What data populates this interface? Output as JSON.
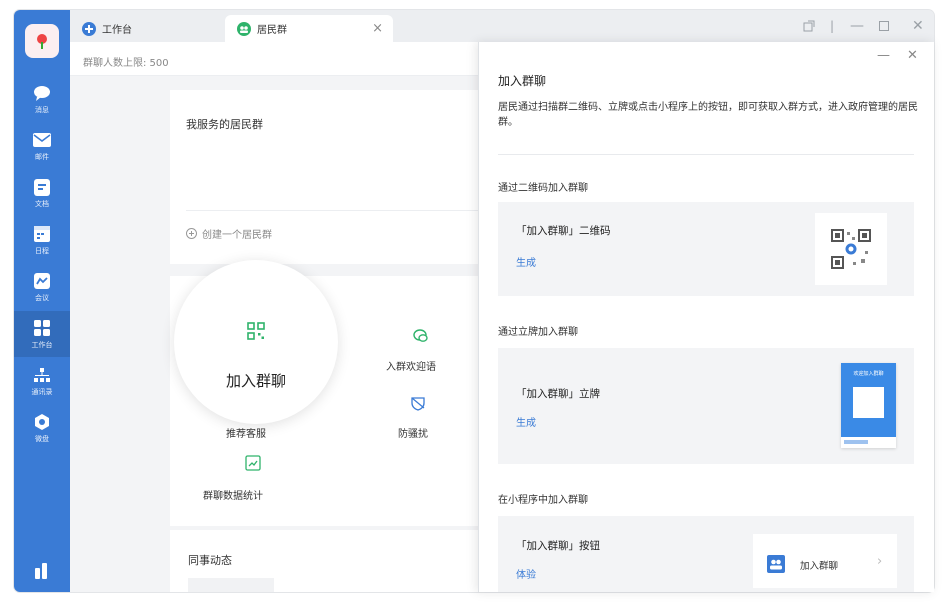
{
  "sidebar": {
    "items": [
      {
        "label": "消息",
        "icon": "chat-icon"
      },
      {
        "label": "邮件",
        "icon": "mail-icon"
      },
      {
        "label": "文档",
        "icon": "document-icon"
      },
      {
        "label": "日程",
        "icon": "calendar-icon"
      },
      {
        "label": "会议",
        "icon": "meeting-icon"
      },
      {
        "label": "工作台",
        "icon": "grid-icon"
      },
      {
        "label": "通讯录",
        "icon": "contacts-icon"
      },
      {
        "label": "微盘",
        "icon": "disk-icon"
      }
    ]
  },
  "tabs": [
    {
      "label": "工作台",
      "icon": "workbench-icon"
    },
    {
      "label": "居民群",
      "icon": "resident-group-icon"
    }
  ],
  "main": {
    "group_limit": "群聊人数上限: 500",
    "my_groups_title": "我服务的居民群",
    "create_group": "创建一个居民群",
    "tools": {
      "join_group": "加入群聊",
      "welcome_message": "入群欢迎语",
      "recommend_service": "推荐客服",
      "anti_harassment": "防骚扰",
      "group_stats": "群聊数据统计"
    },
    "colleague_activity": "同事动态"
  },
  "panel": {
    "title": "加入群聊",
    "description": "居民通过扫描群二维码、立牌或点击小程序上的按钮，即可获取入群方式，进入政府管理的居民群。",
    "sections": [
      {
        "title": "通过二维码加入群聊",
        "name": "「加入群聊」二维码",
        "action": "生成"
      },
      {
        "title": "通过立牌加入群聊",
        "name": "「加入群聊」立牌",
        "action": "生成",
        "stand_title": "欢迎加入群聊"
      },
      {
        "title": "在小程序中加入群聊",
        "name": "「加入群聊」按钮",
        "action": "体验",
        "button_label": "加入群聊"
      }
    ]
  },
  "colors": {
    "brand": "#3a7bd5",
    "icon_green": "#2fb36b",
    "link": "#3a7bd5"
  }
}
